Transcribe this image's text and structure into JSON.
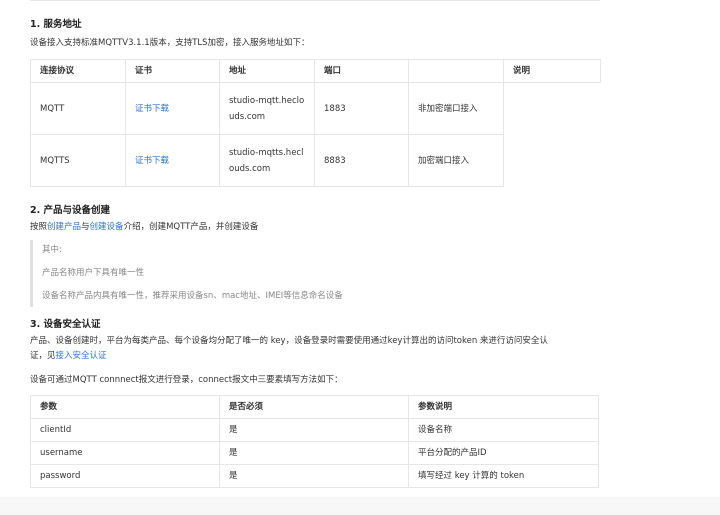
{
  "section1": {
    "title": "1. 服务地址",
    "intro": "设备接入支持标准MQTTV3.1.1版本，支持TLS加密，接入服务地址如下：",
    "headers": [
      "连接协议",
      "证书",
      "地址",
      "端口",
      "",
      "说明"
    ],
    "rows": [
      {
        "protocol": "MQTT",
        "cert": "证书下载",
        "address": "studio-mqtt.heclouds.com",
        "port": "1883",
        "note": "非加密端口接入"
      },
      {
        "protocol": "MQTTS",
        "cert": "证书下载",
        "address": "studio-mqtts.heclouds.com",
        "port": "8883",
        "note": "加密端口接入"
      }
    ]
  },
  "section2": {
    "title": "2. 产品与设备创建",
    "intro_prefix": "按照",
    "link1": "创建产品",
    "intro_mid": "与",
    "link2": "创建设备",
    "intro_suffix": "介绍，创建MQTT产品，并创建设备",
    "quote_lines": [
      "其中:",
      "产品名称用户下具有唯一性",
      "设备名称产品内具有唯一性，推荐采用设备sn、mac地址、IMEI等信息命名设备"
    ]
  },
  "section3": {
    "title": "3. 设备安全认证",
    "text_line1": "产品、设备创建时，平台为每类产品、每个设备均分配了唯一的 key，设备登录时需要使用通过key计算出的访问token 来进行访问安全认",
    "text_line2_prefix": "证，见",
    "text_link": "接入安全认证",
    "connect_text": "设备可通过MQTT connnect报文进行登录，connect报文中三要素填写方法如下：",
    "headers": [
      "参数",
      "是否必须",
      "参数说明"
    ],
    "rows": [
      [
        "clientId",
        "是",
        "设备名称"
      ],
      [
        "username",
        "是",
        "平台分配的产品ID"
      ],
      [
        "password",
        "是",
        "填写经过 key 计算的 token"
      ]
    ]
  }
}
